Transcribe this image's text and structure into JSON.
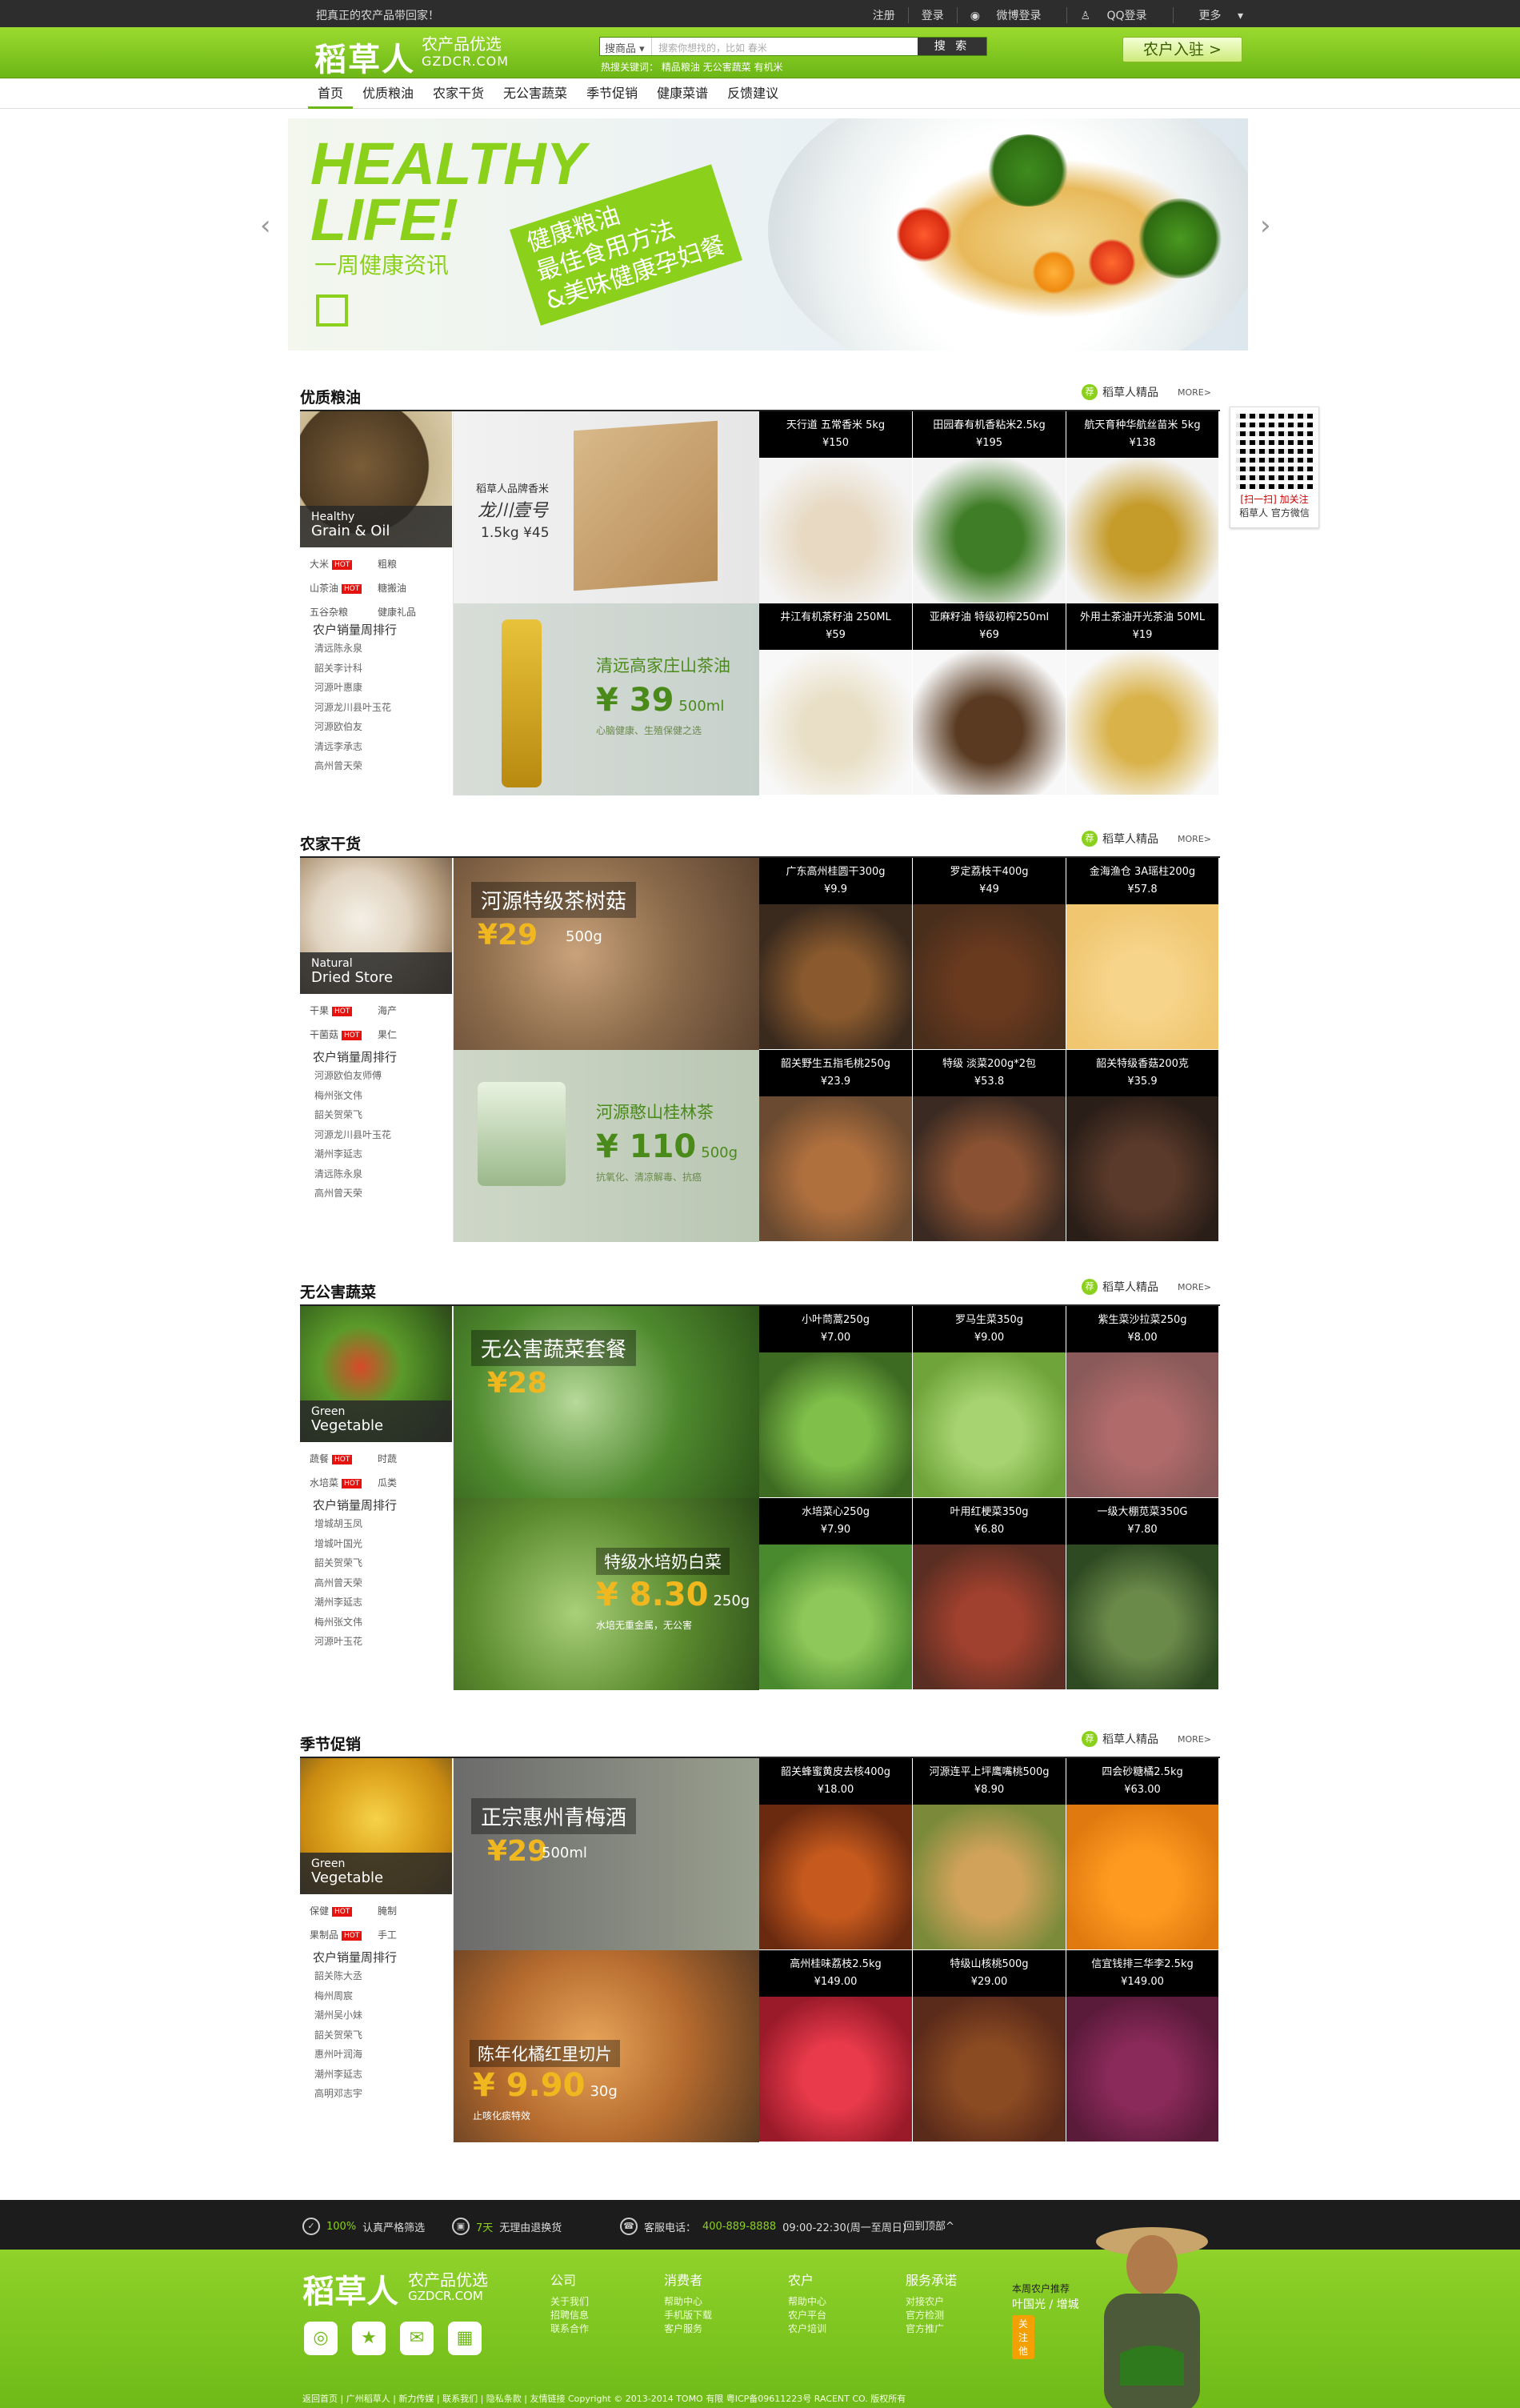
{
  "topbar": {
    "slogan": "把真正的农产品带回家！",
    "links": [
      "注册",
      "登录",
      "微博登录",
      "QQ登录",
      "更多"
    ]
  },
  "header": {
    "logo": "稻草人",
    "logo_sub": "农产品优选",
    "logo_domain": "GZDCR.COM",
    "search_cat": "搜商品",
    "search_placeholder": "搜索你想找的，比如 春米",
    "search_btn": "搜 索",
    "hotkeys": "热搜关键词：  精品粮油   无公害蔬菜   有机米",
    "join": "农户入驻 >"
  },
  "nav": [
    "首页",
    "优质粮油",
    "农家干货",
    "无公害蔬菜",
    "季节促销",
    "健康菜谱",
    "反馈建议"
  ],
  "banner": {
    "healthy": "HEALTHY",
    "life": "LIFE!",
    "week": "一周健康资讯",
    "tag_lines": [
      "健康粮油",
      "最佳食用方法",
      "&美味健康孕妇餐"
    ]
  },
  "qr": {
    "line1": "[扫一扫] 加关注",
    "line2": "稻草人 官方微信"
  },
  "badge": "稻草人精品",
  "more": "MORE>",
  "sections": [
    {
      "title": "优质粮油",
      "cat_en1": "Healthy",
      "cat_en2": "Grain & Oil",
      "tags": [
        {
          "t": "大米",
          "hot": "HOT"
        },
        {
          "t": "粗粮",
          "hot": ""
        },
        {
          "t": "山茶油",
          "hot": "HOT"
        },
        {
          "t": "糖搬油",
          "hot": ""
        },
        {
          "t": "五谷杂粮",
          "hot": ""
        },
        {
          "t": "健康礼品",
          "hot": ""
        }
      ],
      "rank_title": "农户销量周排行",
      "rank": [
        "清远陈永泉",
        "韶关李计科",
        "河源叶惠康",
        "河源龙川县叶玉花",
        "河源欧伯友",
        "清远李承志",
        "高州曾天荣"
      ],
      "feat1": {
        "l1": "稻草人品牌香米",
        "l2": "龙川壹号",
        "l3": "1.5kg ¥45"
      },
      "feat2": {
        "l1": "清远高家庄山茶油",
        "price": "¥ 39",
        "unit": "500ml",
        "l3": "心脑健康、生殖保健之选"
      },
      "products": [
        {
          "name": "天行道 五常香米 5kg",
          "price": "¥150"
        },
        {
          "name": "田园春有机香粘米2.5kg",
          "price": "¥195"
        },
        {
          "name": "航天育种华航丝苗米 5kg",
          "price": "¥138"
        },
        {
          "name": "井江有机茶籽油 250ML",
          "price": "¥59"
        },
        {
          "name": "亚麻籽油 特级初榨250ml",
          "price": "¥69"
        },
        {
          "name": "外用土茶油开光茶油 50ML",
          "price": "¥19"
        }
      ]
    },
    {
      "title": "农家干货",
      "cat_en1": "Natural",
      "cat_en2": "Dried Store",
      "tags": [
        {
          "t": "干果",
          "hot": "HOT"
        },
        {
          "t": "海产",
          "hot": ""
        },
        {
          "t": "干菌菇",
          "hot": "HOT"
        },
        {
          "t": "果仁",
          "hot": ""
        }
      ],
      "rank_title": "农户销量周排行",
      "rank": [
        "河源欧伯友师傅",
        "梅州张文伟",
        "韶关贺荣飞",
        "河源龙川县叶玉花",
        "潮州李延志",
        "清远陈永泉",
        "高州曾天荣"
      ],
      "feat1": {
        "l1": "河源特级茶树菇",
        "l2": "500g",
        "l3": "¥29"
      },
      "feat2": {
        "l1": "河源憨山桂林茶",
        "price": "¥ 110",
        "unit": "500g",
        "l3": "抗氧化、清凉解毒、抗癌"
      },
      "products": [
        {
          "name": "广东高州桂圆干300g",
          "price": "¥9.9"
        },
        {
          "name": "罗定荔枝干400g",
          "price": "¥49"
        },
        {
          "name": "金海渔仓 3A瑶柱200g",
          "price": "¥57.8"
        },
        {
          "name": "韶关野生五指毛桃250g",
          "price": "¥23.9"
        },
        {
          "name": "特级 淡菜200g*2包",
          "price": "¥53.8"
        },
        {
          "name": "韶关特级香菇200克",
          "price": "¥35.9"
        }
      ]
    },
    {
      "title": "无公害蔬菜",
      "cat_en1": "Green",
      "cat_en2": "Vegetable",
      "tags": [
        {
          "t": "蔬餐",
          "hot": "HOT"
        },
        {
          "t": "时蔬",
          "hot": ""
        },
        {
          "t": "水培菜",
          "hot": "HOT"
        },
        {
          "t": "瓜类",
          "hot": ""
        }
      ],
      "rank_title": "农户销量周排行",
      "rank": [
        "增城胡玉凤",
        "增城叶国光",
        "韶关贺荣飞",
        "高州曾天荣",
        "潮州李延志",
        "梅州张文伟",
        "河源叶玉花"
      ],
      "feat1": {
        "l1": "无公害蔬菜套餐",
        "l2": "",
        "l3": "¥28"
      },
      "feat2": {
        "l1": "特级水培奶白菜",
        "price": "¥ 8.30",
        "unit": "250g",
        "l3": "水培无重金属，无公害"
      },
      "products": [
        {
          "name": "小叶茼蒿250g",
          "price": "¥7.00"
        },
        {
          "name": "罗马生菜350g",
          "price": "¥9.00"
        },
        {
          "name": "紫生菜沙拉菜250g",
          "price": "¥8.00"
        },
        {
          "name": "水培菜心250g",
          "price": "¥7.90"
        },
        {
          "name": "叶用红梗菜350g",
          "price": "¥6.80"
        },
        {
          "name": "一级大棚苋菜350G",
          "price": "¥7.80"
        }
      ]
    },
    {
      "title": "季节促销",
      "cat_en1": "Green",
      "cat_en2": "Vegetable",
      "tags": [
        {
          "t": "保健",
          "hot": "HOT"
        },
        {
          "t": "腌制",
          "hot": ""
        },
        {
          "t": "果制品",
          "hot": "HOT"
        },
        {
          "t": "手工",
          "hot": ""
        }
      ],
      "rank_title": "农户销量周排行",
      "rank": [
        "韶关陈大丞",
        "梅州周宸",
        "潮州吴小妹",
        "韶关贺荣飞",
        "惠州叶润海",
        "潮州李延志",
        "高明邓志宇"
      ],
      "feat1": {
        "l1": "正宗惠州青梅酒",
        "l2": "500ml",
        "l3": "¥29"
      },
      "feat2": {
        "l1": "陈年化橘红里切片",
        "price": "¥ 9.90",
        "unit": "30g",
        "l3": "止咳化痰特效"
      },
      "products": [
        {
          "name": "韶关蜂蜜黄皮去核400g",
          "price": "¥18.00"
        },
        {
          "name": "河源连平上坪鹰嘴桃500g",
          "price": "¥8.90"
        },
        {
          "name": "四会砂糖橘2.5kg",
          "price": "¥63.00"
        },
        {
          "name": "高州桂味荔枝2.5kg",
          "price": "¥149.00"
        },
        {
          "name": "特级山核桃500g",
          "price": "¥29.00"
        },
        {
          "name": "信宜钱排三华李2.5kg",
          "price": "¥149.00"
        }
      ]
    }
  ],
  "service": {
    "s1a": "100%",
    "s1b": "认真严格筛选",
    "s2a": "7天",
    "s2b": "无理由退换货",
    "s3a": "客服电话：",
    "s3b": "400-889-8888",
    "s3c": " 09:00-22:30(周一至周日)",
    "top": "回到顶部^"
  },
  "footer": {
    "logo": "稻草人",
    "sub": "农产品优选",
    "domain": "GZDCR.COM",
    "cols": [
      {
        "h": "公司",
        "items": [
          "关于我们",
          "招聘信息",
          "联系合作"
        ]
      },
      {
        "h": "消费者",
        "items": [
          "帮助中心",
          "手机版下载",
          "客户服务"
        ]
      },
      {
        "h": "农户",
        "items": [
          "帮助中心",
          "农户平台",
          "农户培训"
        ]
      },
      {
        "h": "服务承诺",
        "items": [
          "对接农户",
          "官方检测",
          "官方推广"
        ]
      }
    ],
    "copy": "返回首页 | 广州稻草人 | 新力传媒 | 联系我们 | 隐私条款 | 友情链接     Copyright © 2013-2014 TOMO 有限  粤ICP备09611223号 RACENT CO.  版权所有",
    "farmer_t1": "本周农户推荐",
    "farmer_t2": "叶国光 / 增城",
    "farmer_btn": "关注他"
  }
}
